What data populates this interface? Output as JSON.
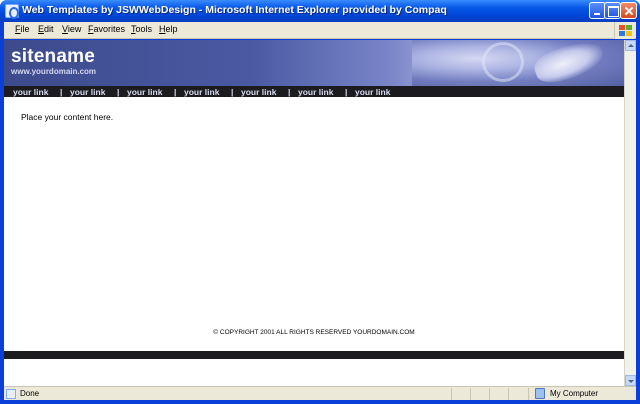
{
  "window": {
    "title": "Web Templates by JSWWebDesign - Microsoft Internet Explorer provided by Compaq"
  },
  "menubar": {
    "items": [
      {
        "first": "F",
        "rest": "ile"
      },
      {
        "first": "E",
        "rest": "dit"
      },
      {
        "first": "V",
        "rest": "iew"
      },
      {
        "first": "F",
        "rest": "avorites"
      },
      {
        "first": "T",
        "rest": "ools"
      },
      {
        "first": "H",
        "rest": "elp"
      }
    ]
  },
  "page": {
    "site_name": "sitename",
    "site_url": "www.yourdomain.com",
    "nav_links": [
      "your link",
      "your link",
      "your link",
      "your link",
      "your link",
      "your link",
      "your link"
    ],
    "nav_separator": "|",
    "content": "Place your content here.",
    "copyright": "© COPYRIGHT 2001 ALL RIGHTS RESERVED YOURDOMAIN.COM"
  },
  "statusbar": {
    "status": "Done",
    "zone": "My Computer"
  },
  "colors": {
    "banner": "#4a5aa2",
    "navbar": "#1c1c20",
    "titlebar": "#0858e8"
  },
  "icons": {
    "title": "ie-page-icon",
    "status": "ie-page-icon",
    "zone": "my-computer-icon",
    "logo": "windows-flag-icon"
  }
}
